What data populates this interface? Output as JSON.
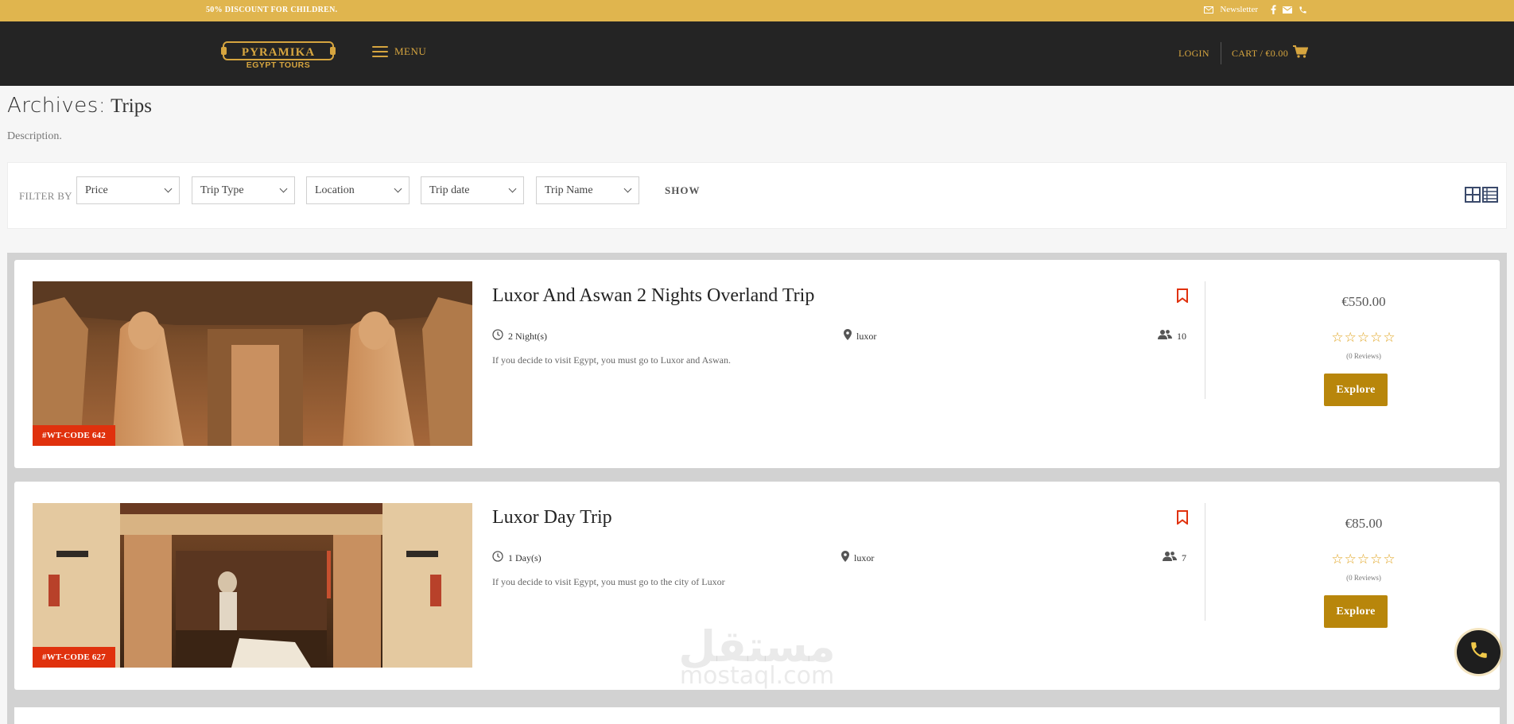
{
  "topbar": {
    "promo": "50% DISCOUNT FOR CHILDREN.",
    "newsletter": "Newsletter",
    "icons": [
      "envelope-icon",
      "facebook-icon",
      "mail-icon",
      "phone-icon"
    ]
  },
  "header": {
    "logo_title": "PYRAMIKA",
    "logo_subtitle": "EGYPT TOURS",
    "menu_label": "MENU",
    "login_label": "LOGIN",
    "cart_label": "CART / €0.00"
  },
  "page": {
    "archives_label": "Archives:",
    "archive_name": "Trips",
    "description": "Description."
  },
  "filter": {
    "label": "FILTER BY",
    "selects": [
      "Price",
      "Trip Type",
      "Location",
      "Trip date",
      "Trip Name"
    ],
    "show_label": "SHOW"
  },
  "trips": [
    {
      "code": "#WT-CODE 642",
      "title": "Luxor And Aswan 2 Nights Overland Trip",
      "duration": "2 Night(s)",
      "location": "luxor",
      "group_size": "10",
      "excerpt": "If you decide to visit Egypt, you must go to Luxor and Aswan.",
      "price": "€550.00",
      "stars": "☆☆☆☆☆",
      "reviews": "(0 Reviews)",
      "explore": "Explore"
    },
    {
      "code": "#WT-CODE 627",
      "title": "Luxor Day Trip",
      "duration": "1 Day(s)",
      "location": "luxor",
      "group_size": "7",
      "excerpt": "If you decide to visit Egypt, you must go to the city of Luxor",
      "price": "€85.00",
      "stars": "☆☆☆☆☆",
      "reviews": "(0 Reviews)",
      "explore": "Explore"
    }
  ],
  "watermark": {
    "arabic": "مستقل",
    "latin": "mostaql.com"
  },
  "colors": {
    "topbar": "#e0b54e",
    "header": "#242424",
    "accent": "#d6a53f",
    "badge": "#e0310d",
    "button": "#b8860b",
    "bookmark": "#e0310d"
  }
}
